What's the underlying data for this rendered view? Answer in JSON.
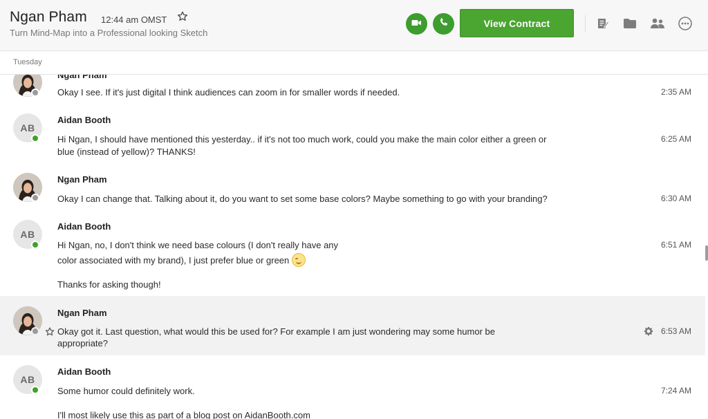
{
  "header": {
    "contact_name": "Ngan Pham",
    "local_time": "12:44 am OMST",
    "subtitle": "Turn Mind-Map into a Professional looking Sketch",
    "view_contract_label": "View Contract"
  },
  "date_label": "Tuesday",
  "messages": [
    {
      "sender": "Ngan Pham",
      "avatar": "photo",
      "status": "offline",
      "text": "Okay I see. If it's just digital I think audiences can zoom in for smaller words if needed.",
      "time": "2:35 AM"
    },
    {
      "sender": "Aidan Booth",
      "avatar_initials": "AB",
      "status": "online",
      "line1": "Hi Ngan, I should have mentioned this yesterday.. if it's not too much work, could you make the main color either a green or",
      "line2": "blue (instead of yellow)? THANKS!",
      "time": "6:25 AM"
    },
    {
      "sender": "Ngan Pham",
      "avatar": "photo",
      "status": "offline",
      "text": "Okay I can change that. Talking about it, do you want to set some base colors? Maybe something to go with your branding?",
      "time": "6:30 AM"
    },
    {
      "sender": "Aidan Booth",
      "avatar_initials": "AB",
      "status": "online",
      "line1": "Hi Ngan, no, I don't think we need base colours (I don't really have any",
      "line2": "color associated with my brand), I just prefer blue or green",
      "emoji": "grinning-face-emoji",
      "line3": "Thanks for asking though!",
      "time": "6:51 AM"
    },
    {
      "sender": "Ngan Pham",
      "avatar": "photo",
      "status": "offline",
      "highlighted": true,
      "line1": "Okay got it. Last question, what would this be used for? For example I am just wondering may some humor be",
      "line2": "appropriate?",
      "time": "6:53 AM"
    },
    {
      "sender": "Aidan Booth",
      "avatar_initials": "AB",
      "status": "online",
      "line1": "Some humor could definitely work.",
      "line2": "I'll most likely use this as part of a blog post on AidanBooth.com",
      "time": "7:24 AM"
    }
  ],
  "colors": {
    "accent_green": "#4aa531",
    "online": "#3ea328",
    "offline": "#9b9b9b",
    "highlight_row": "#f2f2f2"
  },
  "icons": [
    "star-icon",
    "video-call-icon",
    "phone-call-icon",
    "notes-icon",
    "folder-icon",
    "people-icon",
    "more-options-icon",
    "gear-icon"
  ]
}
